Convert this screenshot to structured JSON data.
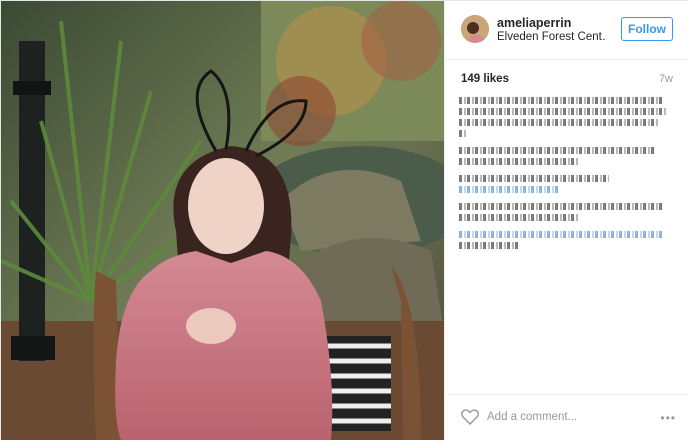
{
  "post": {
    "username": "ameliaperrin",
    "location": "Elveden Forest Cent…",
    "follow_label": "Follow",
    "likes": "149 likes",
    "time_ago": "7w",
    "add_comment_placeholder": "Add a comment...",
    "more_label": "•••",
    "accent": "#3897f0"
  },
  "icons": [
    "heart-icon",
    "more-options-icon"
  ]
}
